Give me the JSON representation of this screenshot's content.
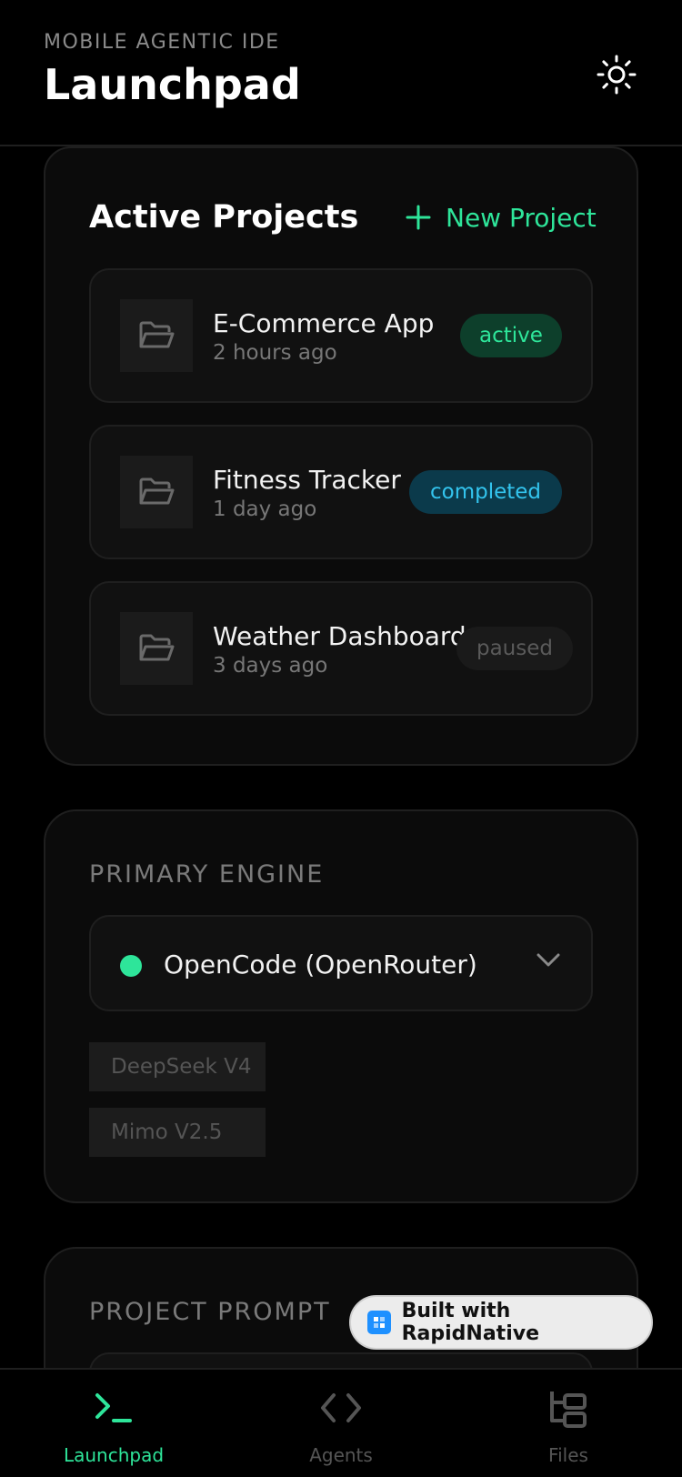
{
  "header": {
    "eyebrow": "MOBILE AGENTIC IDE",
    "title": "Launchpad",
    "theme_icon": "sun-icon"
  },
  "projects": {
    "heading": "Active Projects",
    "new_label": "New Project",
    "items": [
      {
        "name": "E-Commerce App",
        "time": "2 hours ago",
        "status": "active"
      },
      {
        "name": "Fitness Tracker",
        "time": "1 day ago",
        "status": "completed"
      },
      {
        "name": "Weather Dashboard",
        "time": "3 days ago",
        "status": "paused"
      }
    ]
  },
  "engine": {
    "label": "PRIMARY ENGINE",
    "selected": "OpenCode (OpenRouter)",
    "models": [
      "DeepSeek V4",
      "Mimo V2.5"
    ]
  },
  "prompt": {
    "label": "PROJECT PROMPT"
  },
  "badge": {
    "text": "Built with RapidNative"
  },
  "tabs": [
    {
      "label": "Launchpad",
      "icon": "terminal-icon",
      "active": true
    },
    {
      "label": "Agents",
      "icon": "code-brackets-icon",
      "active": false
    },
    {
      "label": "Files",
      "icon": "file-tree-icon",
      "active": false
    }
  ],
  "colors": {
    "accent": "#2ee59a",
    "info": "#33c4ee",
    "background": "#000000",
    "card": "#0b0b0b"
  }
}
